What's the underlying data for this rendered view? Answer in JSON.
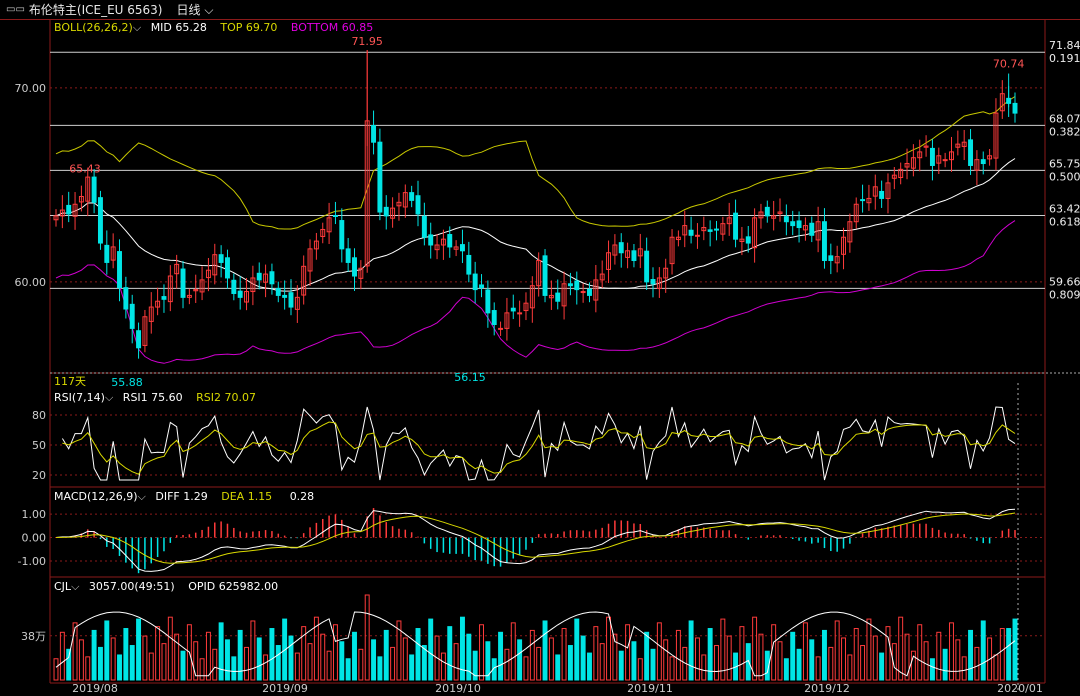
{
  "header": {
    "title": "布伦特主(ICE_EU 6563)",
    "period": "日线",
    "period_icon": "chevron-down-icon",
    "title_icon": "window-icon"
  },
  "colors": {
    "up": "#ff3b3b",
    "down": "#00e5e5",
    "mid": "#ffffff",
    "top": "#c8c800",
    "bottom": "#d000d0",
    "grid": "#8b1a1a",
    "fib": "#cfcfcf"
  },
  "boll": {
    "label": "BOLL(26,26,2)",
    "mid": "MID 65.28",
    "top": "TOP 69.70",
    "bottom": "BOTTOM 60.85"
  },
  "price_axis": [
    {
      "v": 70,
      "label": "70.00"
    },
    {
      "v": 60,
      "label": "60.00"
    }
  ],
  "fib_levels": [
    {
      "price": "71.84",
      "ratio": "0.191",
      "v": 71.84
    },
    {
      "price": "68.07",
      "ratio": "0.382",
      "v": 68.07
    },
    {
      "price": "65.75",
      "ratio": "0.500",
      "v": 65.75
    },
    {
      "price": "63.42",
      "ratio": "0.618",
      "v": 63.42
    },
    {
      "price": "59.66",
      "ratio": "0.809",
      "v": 59.66
    }
  ],
  "annotations": {
    "high": "71.95",
    "high_v": 71.95,
    "recent_high": "70.74",
    "recent_v": 70.74,
    "left_high": "65.43",
    "left_v": 65.43,
    "low1": "55.88",
    "low1_v": 55.88,
    "low2": "56.15",
    "low2_v": 56.15,
    "days": "117天"
  },
  "rsi": {
    "label": "RSI(7,14)",
    "rsi1": "RSI1 75.60",
    "rsi2": "RSI2 70.07",
    "axis": [
      "80",
      "50",
      "20"
    ]
  },
  "macd": {
    "label": "MACD(12,26,9)",
    "diff": "DIFF 1.29",
    "dea": "DEA 1.15",
    "macd": "0.28",
    "axis": [
      "1.00",
      "0.00",
      "-1.00"
    ]
  },
  "cjl": {
    "label": "CJL",
    "vol": "3057.00(49:51)",
    "opid": "OPID 625982.00",
    "axis": "38万"
  },
  "x_axis": [
    "2019/08",
    "2019/09",
    "2019/10",
    "2019/11",
    "2019/12",
    "2020/01"
  ],
  "chart_data": {
    "type": "candlestick",
    "closes": [
      63.4,
      63.7,
      63.5,
      64.0,
      64.4,
      65.4,
      64.1,
      62.0,
      61.0,
      61.8,
      59.7,
      58.6,
      57.6,
      56.6,
      58.2,
      58.7,
      59.0,
      59.1,
      60.3,
      60.9,
      59.2,
      59.3,
      59.6,
      60.1,
      60.6,
      61.4,
      61.0,
      60.2,
      59.4,
      59.2,
      59.5,
      60.2,
      60.1,
      60.4,
      59.9,
      59.3,
      59.2,
      58.7,
      59.2,
      60.8,
      61.7,
      62.1,
      62.7,
      63.3,
      63.4,
      61.7,
      61.0,
      60.3,
      60.7,
      68.3,
      67.2,
      63.6,
      63.4,
      63.8,
      64.1,
      64.6,
      64.2,
      63.5,
      62.3,
      61.9,
      61.9,
      62.2,
      61.8,
      61.8,
      61.6,
      60.4,
      59.6,
      59.7,
      58.4,
      57.8,
      57.6,
      58.4,
      58.5,
      58.4,
      58.9,
      59.8,
      61.1,
      59.3,
      59.3,
      59.0,
      59.9,
      59.8,
      59.6,
      59.5,
      59.3,
      60.1,
      60.4,
      61.5,
      61.9,
      61.5,
      61.6,
      61.1,
      61.7,
      60.0,
      59.9,
      60.2,
      60.7,
      62.3,
      62.3,
      62.9,
      62.4,
      62.4,
      62.8,
      62.6,
      62.7,
      63.0,
      63.3,
      62.2,
      62.2,
      62.0,
      63.3,
      63.6,
      63.4,
      63.4,
      63.6,
      63.1,
      62.9,
      62.8,
      62.9,
      62.4,
      63.1,
      61.1,
      61.1,
      61.3,
      62.3,
      63.1,
      64.0,
      64.2,
      64.3,
      64.9,
      64.3,
      65.1,
      65.5,
      65.8,
      66.1,
      66.4,
      66.7,
      67.0,
      66.0,
      66.5,
      66.3,
      66.7,
      67.1,
      67.2,
      66.0,
      66.3,
      66.1,
      66.5,
      68.7,
      69.7,
      69.2,
      68.7
    ],
    "boll_mid_end": 65.28,
    "boll_top_end": 69.7,
    "boll_bottom_end": 60.85,
    "high_marker": 71.95,
    "recent_high": 70.74,
    "low_markers": [
      55.88,
      56.15
    ],
    "rsi1_end": 75.6,
    "rsi2_end": 70.07,
    "macd_diff_end": 1.29,
    "macd_dea_end": 1.15,
    "macd_hist_end": 0.28,
    "volume_last": 3057.0,
    "open_interest": 625982.0,
    "x_ticks": [
      "2019/08",
      "2019/09",
      "2019/10",
      "2019/11",
      "2019/12",
      "2020/01"
    ]
  }
}
